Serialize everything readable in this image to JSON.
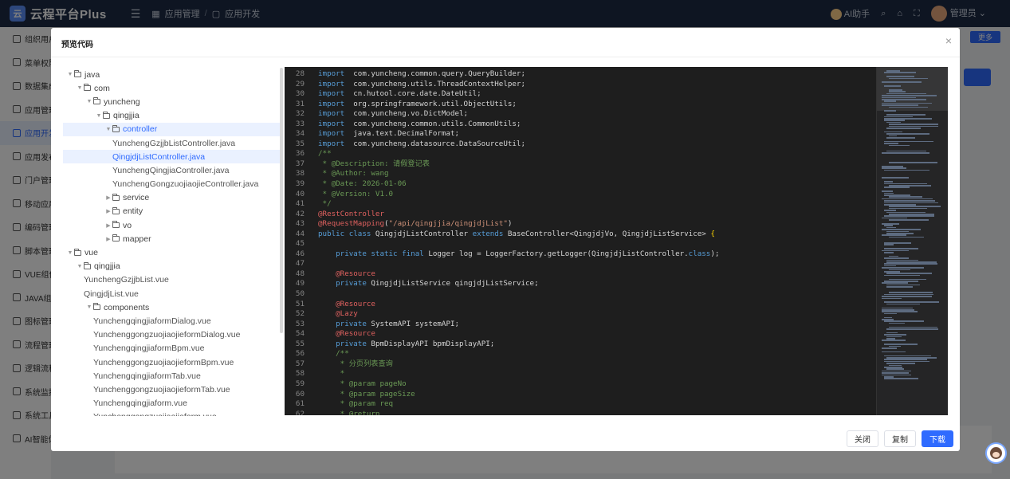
{
  "topbar": {
    "logo_glyph": "云",
    "brand": "云程平台Plus",
    "breadcrumb": [
      "应用管理",
      "应用开发"
    ],
    "ai_label": "AI助手",
    "user_label": "管理员"
  },
  "sidebar": {
    "items": [
      {
        "label": "组织用户",
        "icon": "org-icon"
      },
      {
        "label": "菜单权限",
        "icon": "menu-icon"
      },
      {
        "label": "数据集成",
        "icon": "data-icon"
      },
      {
        "label": "应用管理",
        "icon": "app-icon"
      },
      {
        "label": "应用开发",
        "icon": "dev-icon",
        "active": true
      },
      {
        "label": "应用发布",
        "icon": "publish-icon"
      },
      {
        "label": "门户管理",
        "icon": "portal-icon"
      },
      {
        "label": "移动应用",
        "icon": "mobile-icon"
      },
      {
        "label": "编码管理",
        "icon": "code-icon"
      },
      {
        "label": "脚本管理",
        "icon": "script-icon"
      },
      {
        "label": "VUE组件",
        "icon": "vue-icon"
      },
      {
        "label": "JAVA组件",
        "icon": "java-icon"
      },
      {
        "label": "图标管理",
        "icon": "icon-icon"
      },
      {
        "label": "流程管理",
        "icon": "flow-icon"
      },
      {
        "label": "逻辑流程",
        "icon": "logic-icon"
      },
      {
        "label": "系统监控",
        "icon": "monitor-icon"
      },
      {
        "label": "系统工具",
        "icon": "tools-icon"
      },
      {
        "label": "AI智能体",
        "icon": "ai-icon"
      }
    ]
  },
  "background": {
    "more_label": "更多"
  },
  "modal": {
    "title": "预览代码",
    "close_glyph": "×",
    "buttons": {
      "close": "关闭",
      "copy": "复制",
      "download": "下载"
    }
  },
  "tree": [
    {
      "label": "java",
      "depth": 0,
      "type": "folder",
      "expanded": true
    },
    {
      "label": "com",
      "depth": 1,
      "type": "folder",
      "expanded": true
    },
    {
      "label": "yuncheng",
      "depth": 2,
      "type": "folder",
      "expanded": true
    },
    {
      "label": "qingjjia",
      "depth": 3,
      "type": "folder",
      "expanded": true
    },
    {
      "label": "controller",
      "depth": 4,
      "type": "folder",
      "expanded": true,
      "highlight": true
    },
    {
      "label": "YunchengGzjjbListController.java",
      "depth": 5,
      "type": "file"
    },
    {
      "label": "QingjdjListController.java",
      "depth": 5,
      "type": "file",
      "selected": true
    },
    {
      "label": "YunchengQingjiaController.java",
      "depth": 5,
      "type": "file"
    },
    {
      "label": "YunchengGongzuojiaojieController.java",
      "depth": 5,
      "type": "file"
    },
    {
      "label": "service",
      "depth": 4,
      "type": "folder",
      "expanded": false
    },
    {
      "label": "entity",
      "depth": 4,
      "type": "folder",
      "expanded": false
    },
    {
      "label": "vo",
      "depth": 4,
      "type": "folder",
      "expanded": false
    },
    {
      "label": "mapper",
      "depth": 4,
      "type": "folder",
      "expanded": false
    },
    {
      "label": "vue",
      "depth": 0,
      "type": "folder",
      "expanded": true
    },
    {
      "label": "qingjjia",
      "depth": 1,
      "type": "folder",
      "expanded": true
    },
    {
      "label": "YunchengGzjjbList.vue",
      "depth": 2,
      "type": "file"
    },
    {
      "label": "QingjdjList.vue",
      "depth": 2,
      "type": "file"
    },
    {
      "label": "components",
      "depth": 2,
      "type": "folder",
      "expanded": true
    },
    {
      "label": "YunchengqingjiaformDialog.vue",
      "depth": 3,
      "type": "file"
    },
    {
      "label": "YunchenggongzuojiaojieformDialog.vue",
      "depth": 3,
      "type": "file"
    },
    {
      "label": "YunchengqingjiaformBpm.vue",
      "depth": 3,
      "type": "file"
    },
    {
      "label": "YunchenggongzuojiaojieformBpm.vue",
      "depth": 3,
      "type": "file"
    },
    {
      "label": "YunchengqingjiaformTab.vue",
      "depth": 3,
      "type": "file"
    },
    {
      "label": "YunchenggongzuojiaojieformTab.vue",
      "depth": 3,
      "type": "file"
    },
    {
      "label": "Yunchengqingjiaform.vue",
      "depth": 3,
      "type": "file"
    },
    {
      "label": "Yunchenggongzuojiaojieform.vue",
      "depth": 3,
      "type": "file"
    }
  ],
  "code": {
    "lines": [
      {
        "n": "28",
        "tokens": [
          [
            "kw",
            "import"
          ],
          [
            "",
            "  com.yuncheng.common.query.QueryBuilder;"
          ]
        ]
      },
      {
        "n": "29",
        "tokens": [
          [
            "kw",
            "import"
          ],
          [
            "",
            "  com.yuncheng.utils.ThreadContextHelper;"
          ]
        ]
      },
      {
        "n": "30",
        "tokens": [
          [
            "kw",
            "import"
          ],
          [
            "",
            "  cn.hutool.core.date.DateUtil;"
          ]
        ]
      },
      {
        "n": "31",
        "tokens": [
          [
            "kw",
            "import"
          ],
          [
            "",
            "  org.springframework.util.ObjectUtils;"
          ]
        ]
      },
      {
        "n": "32",
        "tokens": [
          [
            "kw",
            "import"
          ],
          [
            "",
            "  com.yuncheng.vo.DictModel;"
          ]
        ]
      },
      {
        "n": "33",
        "tokens": [
          [
            "kw",
            "import"
          ],
          [
            "",
            "  com.yuncheng.common.utils.CommonUtils;"
          ]
        ]
      },
      {
        "n": "34",
        "tokens": [
          [
            "kw",
            "import"
          ],
          [
            "",
            "  java.text.DecimalFormat;"
          ]
        ]
      },
      {
        "n": "35",
        "tokens": [
          [
            "kw",
            "import"
          ],
          [
            "",
            "  com.yuncheng.datasource.DataSourceUtil;"
          ]
        ]
      },
      {
        "n": "36",
        "tokens": [
          [
            "cm",
            "/**"
          ]
        ]
      },
      {
        "n": "37",
        "tokens": [
          [
            "cm",
            " * @Description: 请假登记表"
          ]
        ]
      },
      {
        "n": "38",
        "tokens": [
          [
            "cm",
            " * @Author: wang"
          ]
        ]
      },
      {
        "n": "39",
        "tokens": [
          [
            "cm",
            " * @Date: 2026-01-06"
          ]
        ]
      },
      {
        "n": "40",
        "tokens": [
          [
            "cm",
            " * @Version: V1.0"
          ]
        ]
      },
      {
        "n": "41",
        "tokens": [
          [
            "cm",
            " */"
          ]
        ]
      },
      {
        "n": "42",
        "tokens": [
          [
            "an",
            "@RestController"
          ]
        ]
      },
      {
        "n": "43",
        "tokens": [
          [
            "an",
            "@RequestMapping"
          ],
          [
            "",
            "("
          ],
          [
            "st",
            "\"/api/qingjjia/qingjdjList\""
          ],
          [
            "",
            ")"
          ]
        ]
      },
      {
        "n": "44",
        "tokens": [
          [
            "kw",
            "public class"
          ],
          [
            "",
            " QingjdjListController "
          ],
          [
            "kw",
            "extends"
          ],
          [
            "",
            " BaseController<QingjdjVo, QingjdjListService> "
          ],
          [
            "br",
            "{"
          ]
        ]
      },
      {
        "n": "45",
        "tokens": [
          [
            "",
            ""
          ]
        ]
      },
      {
        "n": "46",
        "tokens": [
          [
            "",
            "    "
          ],
          [
            "kw",
            "private static final"
          ],
          [
            "",
            " Logger log = LoggerFactory.getLogger(QingjdjListController."
          ],
          [
            "cl",
            "class"
          ],
          [
            "",
            ");"
          ]
        ]
      },
      {
        "n": "47",
        "tokens": [
          [
            "",
            ""
          ]
        ]
      },
      {
        "n": "48",
        "tokens": [
          [
            "",
            "    "
          ],
          [
            "an",
            "@Resource"
          ]
        ]
      },
      {
        "n": "49",
        "tokens": [
          [
            "",
            "    "
          ],
          [
            "kw",
            "private"
          ],
          [
            "",
            " QingjdjListService qingjdjListService;"
          ]
        ]
      },
      {
        "n": "50",
        "tokens": [
          [
            "",
            ""
          ]
        ]
      },
      {
        "n": "51",
        "tokens": [
          [
            "",
            "    "
          ],
          [
            "an",
            "@Resource"
          ]
        ]
      },
      {
        "n": "52",
        "tokens": [
          [
            "",
            "    "
          ],
          [
            "an",
            "@Lazy"
          ]
        ]
      },
      {
        "n": "53",
        "tokens": [
          [
            "",
            "    "
          ],
          [
            "kw",
            "private"
          ],
          [
            "",
            " SystemAPI systemAPI;"
          ]
        ]
      },
      {
        "n": "54",
        "tokens": [
          [
            "",
            "    "
          ],
          [
            "an",
            "@Resource"
          ]
        ]
      },
      {
        "n": "55",
        "tokens": [
          [
            "",
            "    "
          ],
          [
            "kw",
            "private"
          ],
          [
            "",
            " BpmDisplayAPI bpmDisplayAPI;"
          ]
        ]
      },
      {
        "n": "56",
        "tokens": [
          [
            "",
            "    "
          ],
          [
            "cm",
            "/**"
          ]
        ]
      },
      {
        "n": "57",
        "tokens": [
          [
            "",
            "    "
          ],
          [
            "cm",
            " * 分页列表查询"
          ]
        ]
      },
      {
        "n": "58",
        "tokens": [
          [
            "",
            "    "
          ],
          [
            "cm",
            " *"
          ]
        ]
      },
      {
        "n": "59",
        "tokens": [
          [
            "",
            "    "
          ],
          [
            "cm",
            " * @param pageNo"
          ]
        ]
      },
      {
        "n": "60",
        "tokens": [
          [
            "",
            "    "
          ],
          [
            "cm",
            " * @param pageSize"
          ]
        ]
      },
      {
        "n": "61",
        "tokens": [
          [
            "",
            "    "
          ],
          [
            "cm",
            " * @param req"
          ]
        ]
      },
      {
        "n": "62",
        "tokens": [
          [
            "",
            "    "
          ],
          [
            "cm",
            " * @return"
          ]
        ]
      }
    ]
  },
  "colors": {
    "accent": "#2f6bff",
    "topbar_bg": "#1d2b45",
    "code_bg": "#1e1e1e"
  }
}
